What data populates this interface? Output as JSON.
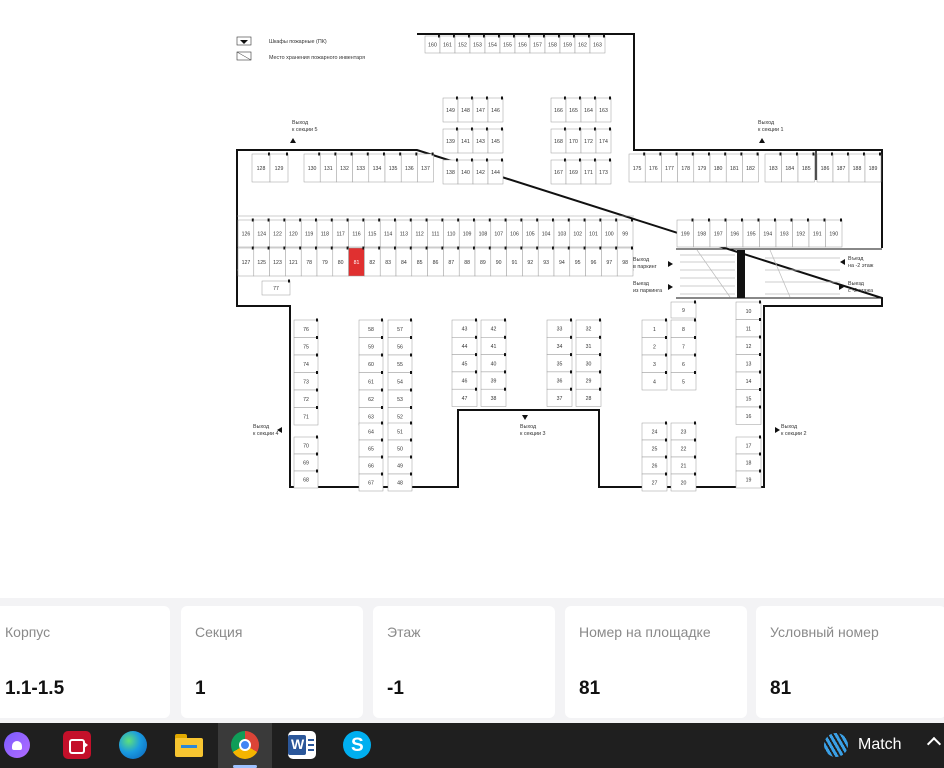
{
  "legend": {
    "fire_cabinet": "Шкафы пожарные (ПК)",
    "inventory": "Место хранения пожарного инвентаря"
  },
  "exits": {
    "s5": [
      "Выход",
      "к секции 5"
    ],
    "s1": [
      "Выход",
      "к секции 1"
    ],
    "s4": [
      "Выход",
      "к секции 4"
    ],
    "s2": [
      "Выход",
      "к секции 2"
    ],
    "s3": [
      "Выход",
      "к секции 3"
    ],
    "to_parking": [
      "Выход",
      "в паркинг"
    ],
    "from_parking": [
      "Выезд",
      "из паркинга"
    ],
    "to_minus2": [
      "Въезд",
      "на -2 этаж"
    ],
    "from_minus2": [
      "Выезд",
      "с -2 этажа"
    ]
  },
  "spots": {
    "top": [
      "160",
      "161",
      "152",
      "153",
      "154",
      "155",
      "156",
      "157",
      "158",
      "159",
      "162",
      "163"
    ],
    "c1r1": [
      "149",
      "148",
      "147",
      "146"
    ],
    "c1r2": [
      "139",
      "141",
      "143",
      "145"
    ],
    "c1r3": [
      "138",
      "140",
      "142",
      "144"
    ],
    "c2r1": [
      "166",
      "165",
      "164",
      "163"
    ],
    "c2r2": [
      "168",
      "170",
      "172",
      "174"
    ],
    "c2r3": [
      "167",
      "169",
      "171",
      "173"
    ],
    "row1_left": [
      "128",
      "129"
    ],
    "row1_mid": [
      "130",
      "131",
      "132",
      "133",
      "134",
      "135",
      "136",
      "137"
    ],
    "row1_right": [
      "175",
      "176",
      "177",
      "178",
      "179",
      "180",
      "181",
      "182"
    ],
    "row1_far": [
      "183",
      "184",
      "185"
    ],
    "row1_end": [
      "186",
      "187",
      "188",
      "189"
    ],
    "row2": [
      "126",
      "124",
      "122",
      "120",
      "119",
      "118",
      "117",
      "116",
      "115",
      "114",
      "113",
      "112",
      "111",
      "110",
      "109",
      "108",
      "107",
      "106",
      "105",
      "104",
      "103",
      "102",
      "101",
      "100",
      "99"
    ],
    "row2_right": [
      "199",
      "198",
      "197",
      "196",
      "195",
      "194",
      "193",
      "192",
      "191",
      "190"
    ],
    "row3": [
      "127",
      "125",
      "123",
      "121",
      "78",
      "79",
      "80",
      "81",
      "82",
      "83",
      "84",
      "85",
      "86",
      "87",
      "88",
      "89",
      "90",
      "91",
      "92",
      "93",
      "94",
      "95",
      "96",
      "97",
      "98"
    ],
    "spot77": "77",
    "a_col1": [
      "76",
      "75",
      "74",
      "73",
      "72",
      "71"
    ],
    "a_col1b": [
      "70",
      "69",
      "68"
    ],
    "b_l": [
      "58",
      "59",
      "60",
      "61",
      "62",
      "63"
    ],
    "b_r": [
      "57",
      "56",
      "55",
      "54",
      "53",
      "52"
    ],
    "b_lb": [
      "64",
      "65",
      "66",
      "67"
    ],
    "b_rb": [
      "51",
      "50",
      "49",
      "48"
    ],
    "c_l": [
      "43",
      "44",
      "45",
      "46",
      "47"
    ],
    "c_r": [
      "42",
      "41",
      "40",
      "39",
      "38"
    ],
    "d_l": [
      "33",
      "34",
      "35",
      "36",
      "37"
    ],
    "d_r": [
      "32",
      "31",
      "30",
      "29",
      "28"
    ],
    "e_l": [
      "1",
      "2",
      "3",
      "4"
    ],
    "e_r": [
      "8",
      "7",
      "6",
      "5"
    ],
    "e_lb": [
      "24",
      "25",
      "26",
      "27"
    ],
    "e_rb": [
      "23",
      "22",
      "21",
      "20"
    ],
    "spot9": "9",
    "f_col": [
      "10",
      "11",
      "12",
      "13",
      "14",
      "15",
      "16"
    ],
    "f_colb": [
      "17",
      "18",
      "19"
    ]
  },
  "highlight_color": "#e03030",
  "cards": [
    {
      "caption": "Корпус",
      "value": "1.1-1.5"
    },
    {
      "caption": "Секция",
      "value": "1"
    },
    {
      "caption": "Этаж",
      "value": "-1"
    },
    {
      "caption": "Номер на площадке",
      "value": "81"
    },
    {
      "caption": "Условный номер",
      "value": "81"
    }
  ],
  "taskbar": {
    "icons": [
      "assistant-icon",
      "screen-recorder-icon",
      "edge-browser-icon",
      "file-explorer-icon",
      "chrome-icon",
      "word-icon",
      "skype-icon"
    ],
    "weather_label": "Match",
    "tray": "chevron-up-icon"
  }
}
